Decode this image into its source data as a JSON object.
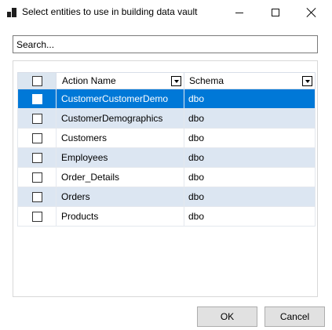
{
  "window": {
    "title": "Select entities to use in building data vault",
    "controls": {
      "minimize": "—",
      "maximize": "☐",
      "close": "✕"
    }
  },
  "search": {
    "value": "",
    "placeholder": "Search..."
  },
  "grid": {
    "columns": [
      "Action Name",
      "Schema"
    ],
    "rows": [
      {
        "name": "CustomerCustomerDemo",
        "schema": "dbo",
        "checked": false,
        "selected": true
      },
      {
        "name": "CustomerDemographics",
        "schema": "dbo",
        "checked": false,
        "selected": false
      },
      {
        "name": "Customers",
        "schema": "dbo",
        "checked": false,
        "selected": false
      },
      {
        "name": "Employees",
        "schema": "dbo",
        "checked": false,
        "selected": false
      },
      {
        "name": "Order_Details",
        "schema": "dbo",
        "checked": false,
        "selected": false
      },
      {
        "name": "Orders",
        "schema": "dbo",
        "checked": false,
        "selected": false
      },
      {
        "name": "Products",
        "schema": "dbo",
        "checked": false,
        "selected": false
      }
    ]
  },
  "buttons": {
    "ok": "OK",
    "cancel": "Cancel"
  },
  "colors": {
    "selection": "#0078d7",
    "alt_row": "#dce6f2",
    "button_face": "#e1e1e1"
  }
}
